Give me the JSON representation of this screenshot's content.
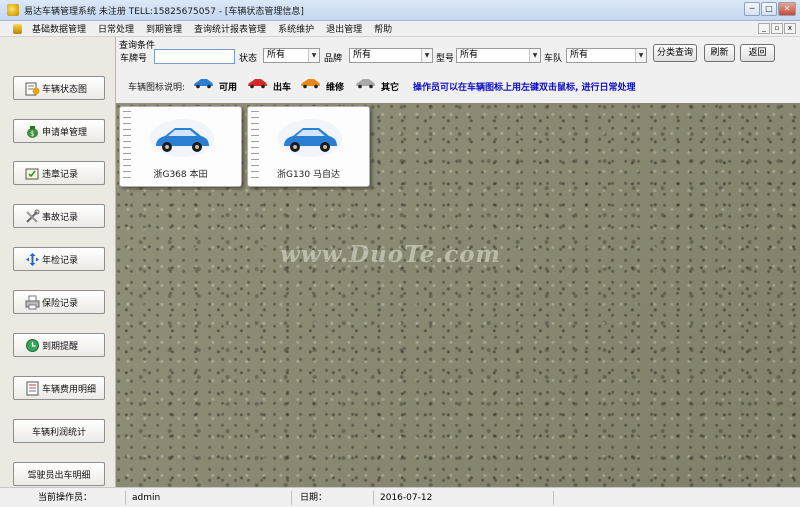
{
  "window": {
    "title": "易达车辆管理系统 未注册 TELL:15825675057 - [车辆状态管理信息]",
    "minimize": "─",
    "maximize": "□",
    "close": "✕"
  },
  "menubar": {
    "items": [
      "基础数据管理",
      "日常处理",
      "到期管理",
      "查询统计报表管理",
      "系统维护",
      "退出管理",
      "帮助"
    ],
    "mdi": [
      "_",
      "▫",
      "x"
    ]
  },
  "sidebar": {
    "items": [
      {
        "label": "车辆状态图",
        "icon": "car-status-icon"
      },
      {
        "label": "申请单管理",
        "icon": "money-bag-icon"
      },
      {
        "label": "违章记录",
        "icon": "violation-icon"
      },
      {
        "label": "事故记录",
        "icon": "tools-icon"
      },
      {
        "label": "年检记录",
        "icon": "arrows-icon"
      },
      {
        "label": "保险记录",
        "icon": "printer-icon"
      },
      {
        "label": "到期提醒",
        "icon": "alarm-icon"
      },
      {
        "label": "车辆费用明细",
        "icon": "ledger-icon"
      },
      {
        "label": "车辆利润统计",
        "icon": ""
      },
      {
        "label": "驾驶员出车明细",
        "icon": ""
      }
    ]
  },
  "query": {
    "group_label": "查询条件",
    "plate_label": "车牌号",
    "plate_value": "",
    "status_label": "状态",
    "status_value": "所有",
    "brand_label": "品牌",
    "brand_value": "所有",
    "model_label": "型号",
    "model_value": "所有",
    "team_label": "车队",
    "team_value": "所有",
    "classify_button": "分类查询",
    "refresh_button": "刷新",
    "back_button": "返回"
  },
  "legend": {
    "title": "车辆图标说明:",
    "items": [
      {
        "label": "可用",
        "color": "#2a7fd4"
      },
      {
        "label": "出车",
        "color": "#d42a2a"
      },
      {
        "label": "维修",
        "color": "#e8871e"
      },
      {
        "label": "其它",
        "color": "#a8a8a8"
      }
    ],
    "hint": "操作员可以在车辆图标上用左键双击鼠标, 进行日常处理"
  },
  "cars": [
    {
      "plate": "浙G368 本田",
      "color": "#2a7fd4"
    },
    {
      "plate": "浙G130 马自达",
      "color": "#2a7fd4"
    }
  ],
  "watermark": "www.DuoTe.com",
  "statusbar": {
    "operator_label": "当前操作员：",
    "operator_value": "admin",
    "date_label": "日期：",
    "date_value": "2016-07-12"
  }
}
